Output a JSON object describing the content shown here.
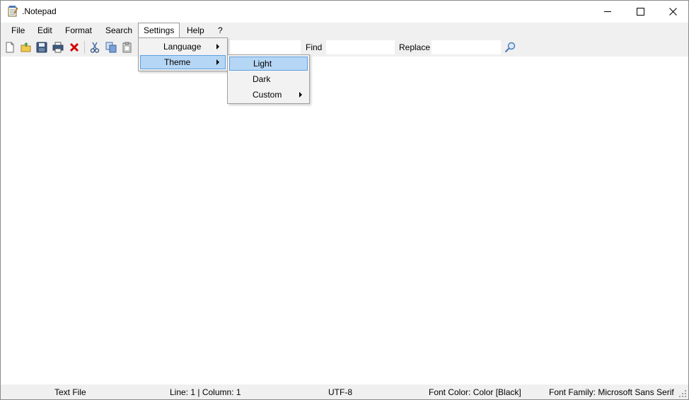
{
  "window": {
    "title": ".Notepad"
  },
  "menu": {
    "file": "File",
    "edit": "Edit",
    "format": "Format",
    "search": "Search",
    "settings": "Settings",
    "help": "Help",
    "about": "?"
  },
  "settings_menu": {
    "language": "Language",
    "theme": "Theme"
  },
  "theme_menu": {
    "light": "Light",
    "dark": "Dark",
    "custom": "Custom"
  },
  "toolbar": {
    "icons": [
      "new-file-icon",
      "open-folder-icon",
      "save-icon",
      "print-icon",
      "delete-icon",
      "cut-icon",
      "copy-icon",
      "paste-icon",
      "search-icon"
    ],
    "find_label": "Find",
    "find_value": "",
    "replace_label": "Replace",
    "replace_value": "",
    "goto_value": ""
  },
  "editor": {
    "content": ""
  },
  "status": {
    "file_type": "Text File",
    "position": "Line: 1 | Column: 1",
    "encoding": "UTF-8",
    "font_color": "Font Color: Color [Black]",
    "font_family": "Font Family: Microsoft Sans Serif"
  },
  "colors": {
    "highlight_fill": "#b6d6f5",
    "highlight_border": "#5da0e0",
    "delete_icon": "#d40000"
  }
}
